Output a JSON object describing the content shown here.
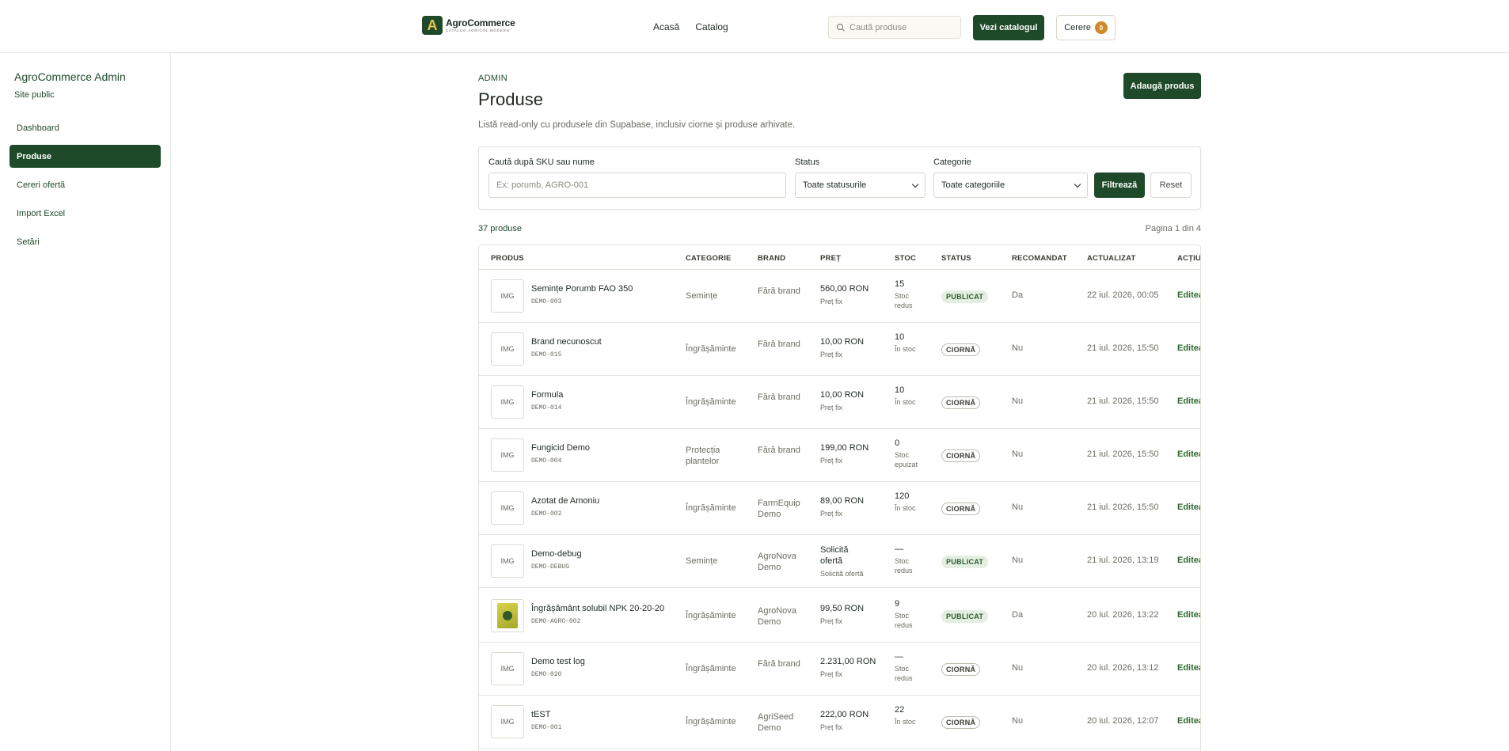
{
  "header": {
    "logo_name": "AgroCommerce",
    "logo_sub": "CATALOG AGRICOL MODERN",
    "logo_letter": "A",
    "nav": [
      "Acasă",
      "Catalog"
    ],
    "search_placeholder": "Caută produse",
    "catalog_button": "Vezi catalogul",
    "cerere_label": "Cerere",
    "cerere_count": "0"
  },
  "sidebar": {
    "title": "AgroCommerce Admin",
    "public_link": "Site public",
    "items": [
      {
        "label": "Dashboard",
        "active": false
      },
      {
        "label": "Produse",
        "active": true
      },
      {
        "label": "Cereri ofertă",
        "active": false
      },
      {
        "label": "Import Excel",
        "active": false
      },
      {
        "label": "Setări",
        "active": false
      }
    ]
  },
  "main": {
    "eyebrow": "ADMIN",
    "title": "Produse",
    "description": "Listă read-only cu produsele din Supabase, inclusiv ciorne și produse arhivate.",
    "add_button": "Adaugă produs",
    "filters": {
      "search_label": "Caută după SKU sau nume",
      "search_placeholder": "Ex: porumb, AGRO-001",
      "status_label": "Status",
      "status_value": "Toate statusurile",
      "category_label": "Categorie",
      "category_value": "Toate categoriile",
      "filter_button": "Filtrează",
      "reset_button": "Reset"
    },
    "count": "37 produse",
    "page_info": "Pagina 1 din 4",
    "columns": [
      "PRODUS",
      "CATEGORIE",
      "BRAND",
      "PREȚ",
      "STOC",
      "STATUS",
      "RECOMANDAT",
      "ACTUALIZAT",
      "ACȚIUNI"
    ],
    "rows": [
      {
        "name": "Semințe Porumb FAO 350",
        "sku": "DEMO-003",
        "thumb": "IMG",
        "category": "Semințe",
        "brand": "Fără brand",
        "price": "560,00 RON",
        "price_note": "Preț fix",
        "stock": "15",
        "stock_note": "Stoc redus",
        "status": "PUBLICAT",
        "published": true,
        "recommended": "Da",
        "updated": "22 iul. 2026, 00:05",
        "action": "Editează"
      },
      {
        "name": "Brand necunoscut",
        "sku": "DEMO-015",
        "thumb": "IMG",
        "category": "Îngrășăminte",
        "brand": "Fără brand",
        "price": "10,00 RON",
        "price_note": "Preț fix",
        "stock": "10",
        "stock_note": "În stoc",
        "status": "CIORNĂ",
        "published": false,
        "recommended": "Nu",
        "updated": "21 iul. 2026, 15:50",
        "action": "Editează"
      },
      {
        "name": "Formula",
        "sku": "DEMO-014",
        "thumb": "IMG",
        "category": "Îngrășăminte",
        "brand": "Fără brand",
        "price": "10,00 RON",
        "price_note": "Preț fix",
        "stock": "10",
        "stock_note": "În stoc",
        "status": "CIORNĂ",
        "published": false,
        "recommended": "Nu",
        "updated": "21 iul. 2026, 15:50",
        "action": "Editează"
      },
      {
        "name": "Fungicid Demo",
        "sku": "DEMO-004",
        "thumb": "IMG",
        "category": "Protecția plantelor",
        "brand": "Fără brand",
        "price": "199,00 RON",
        "price_note": "Preț fix",
        "stock": "0",
        "stock_note": "Stoc epuizat",
        "status": "CIORNĂ",
        "published": false,
        "recommended": "Nu",
        "updated": "21 iul. 2026, 15:50",
        "action": "Editează"
      },
      {
        "name": "Azotat de Amoniu",
        "sku": "DEMO-002",
        "thumb": "IMG",
        "category": "Îngrășăminte",
        "brand": "FarmEquip Demo",
        "price": "89,00 RON",
        "price_note": "Preț fix",
        "stock": "120",
        "stock_note": "În stoc",
        "status": "CIORNĂ",
        "published": false,
        "recommended": "Nu",
        "updated": "21 iul. 2026, 15:50",
        "action": "Editează"
      },
      {
        "name": "Demo-debug",
        "sku": "DEMO-DEBUG",
        "thumb": "IMG",
        "category": "Semințe",
        "brand": "AgroNova Demo",
        "price": "Solicită ofertă",
        "price_note": "Solicită ofertă",
        "stock": "—",
        "stock_note": "Stoc redus",
        "status": "PUBLICAT",
        "published": true,
        "recommended": "Nu",
        "updated": "21 iul. 2026, 13:19",
        "action": "Editează"
      },
      {
        "name": "Îngrășământ solubil NPK 20-20-20",
        "sku": "DEMO-AGRO-002",
        "thumb": "",
        "category": "Îngrășăminte",
        "brand": "AgroNova Demo",
        "price": "99,50 RON",
        "price_note": "Preț fix",
        "stock": "9",
        "stock_note": "Stoc redus",
        "status": "PUBLICAT",
        "published": true,
        "recommended": "Da",
        "updated": "20 iul. 2026, 13:22",
        "action": "Editează"
      },
      {
        "name": "Demo test log",
        "sku": "DEMO-020",
        "thumb": "IMG",
        "category": "Îngrășăminte",
        "brand": "Fără brand",
        "price": "2.231,00 RON",
        "price_note": "Preț fix",
        "stock": "—",
        "stock_note": "Stoc redus",
        "status": "CIORNĂ",
        "published": false,
        "recommended": "Nu",
        "updated": "20 iul. 2026, 13:12",
        "action": "Editează"
      },
      {
        "name": "tEST",
        "sku": "DEMO-001",
        "thumb": "IMG",
        "category": "Îngrășăminte",
        "brand": "AgriSeed Demo",
        "price": "222,00 RON",
        "price_note": "Preț fix",
        "stock": "22",
        "stock_note": "În stoc",
        "status": "CIORNĂ",
        "published": false,
        "recommended": "Nu",
        "updated": "20 iul. 2026, 12:07",
        "action": "Editează"
      }
    ]
  }
}
